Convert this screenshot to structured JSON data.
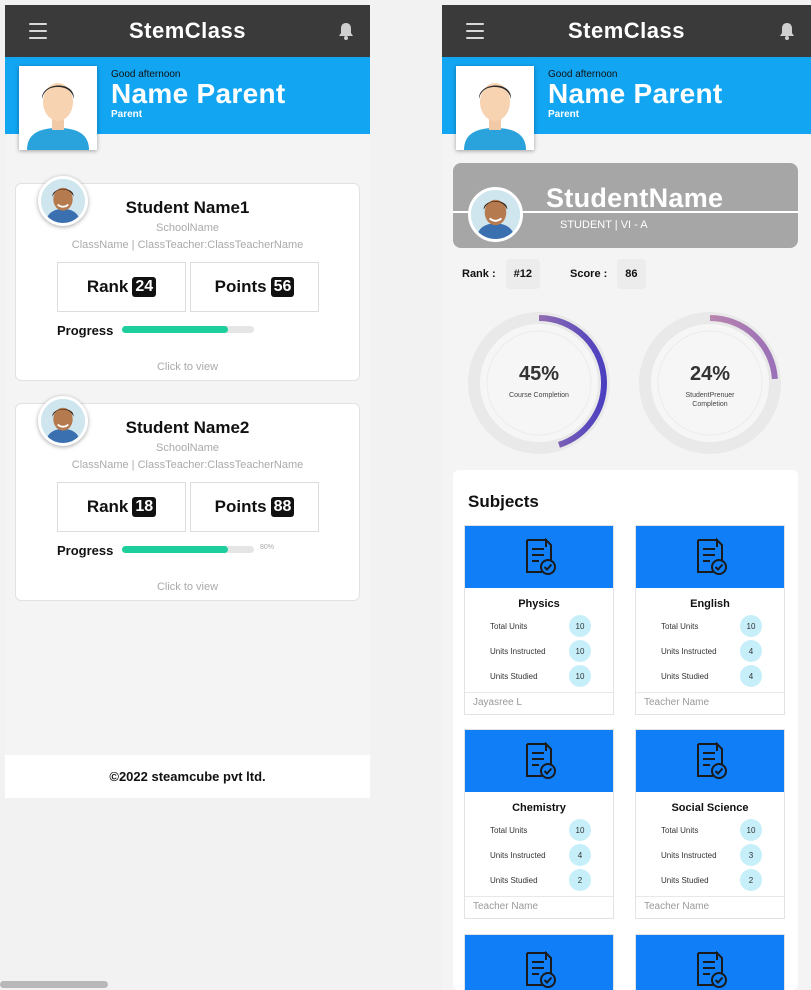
{
  "app": {
    "brand": "StemClass"
  },
  "left_screen": {
    "header": {
      "greeting": "Good afternoon",
      "name": "Name Parent",
      "role": "Parent"
    },
    "students": [
      {
        "name": "Student Name1",
        "school": "SchoolName",
        "class_line": "ClassName | ClassTeacher:ClassTeacherName",
        "rank_label": "Rank",
        "rank": "24",
        "points_label": "Points",
        "points": "56",
        "progress_label": "Progress",
        "progress_fraction": 0.8,
        "progress_text": "",
        "view_label": "Click to view"
      },
      {
        "name": "Student Name2",
        "school": "SchoolName",
        "class_line": "ClassName | ClassTeacher:ClassTeacherName",
        "rank_label": "Rank",
        "rank": "18",
        "points_label": "Points",
        "points": "88",
        "progress_label": "Progress",
        "progress_fraction": 0.8,
        "progress_text": "80%",
        "view_label": "Click to view"
      }
    ],
    "footer": "©2022 steamcube pvt ltd."
  },
  "right_screen": {
    "header": {
      "greeting": "Good afternoon",
      "name": "Name Parent",
      "role": "Parent"
    },
    "student": {
      "name": "StudentName",
      "class_line": "STUDENT | VI - A"
    },
    "rank_label": "Rank :",
    "rank": "#12",
    "score_label": "Score :",
    "score": "86",
    "rings": [
      {
        "percent_text": "45%",
        "fraction": 0.45,
        "label": "Course Completion",
        "gradient": [
          "#d69aa3",
          "#4b3fc0"
        ]
      },
      {
        "percent_text": "24%",
        "fraction": 0.24,
        "label": "StudentPrenuer Completion",
        "gradient": [
          "#d69aa3",
          "#9a70b8"
        ]
      }
    ],
    "subjects_title": "Subjects",
    "subjects": [
      {
        "name": "Physics",
        "rows": [
          {
            "label": "Total Units",
            "value": "10"
          },
          {
            "label": "Units Instructed",
            "value": "10"
          },
          {
            "label": "Units Studied",
            "value": "10"
          }
        ],
        "teacher": "Jayasree L"
      },
      {
        "name": "English",
        "rows": [
          {
            "label": "Total Units",
            "value": "10"
          },
          {
            "label": "Units Instructed",
            "value": "4"
          },
          {
            "label": "Units Studied",
            "value": "4"
          }
        ],
        "teacher": "Teacher Name"
      },
      {
        "name": "Chemistry",
        "rows": [
          {
            "label": "Total Units",
            "value": "10"
          },
          {
            "label": "Units Instructed",
            "value": "4"
          },
          {
            "label": "Units Studied",
            "value": "2"
          }
        ],
        "teacher": "Teacher Name"
      },
      {
        "name": "Social Science",
        "rows": [
          {
            "label": "Total Units",
            "value": "10"
          },
          {
            "label": "Units Instructed",
            "value": "3"
          },
          {
            "label": "Units Studied",
            "value": "2"
          }
        ],
        "teacher": "Teacher Name"
      }
    ]
  },
  "colors": {
    "topbar": "#3a3a3a",
    "header_blue": "#12a5f2",
    "subject_blue": "#0f7ef7",
    "progress_green": "#1ccf9c",
    "unit_badge": "#c6effa",
    "banner_gray": "#a6a6a6"
  },
  "icons": {
    "menu": "hamburger-menu-icon",
    "bell": "bell-icon",
    "subject": "document-check-icon"
  }
}
